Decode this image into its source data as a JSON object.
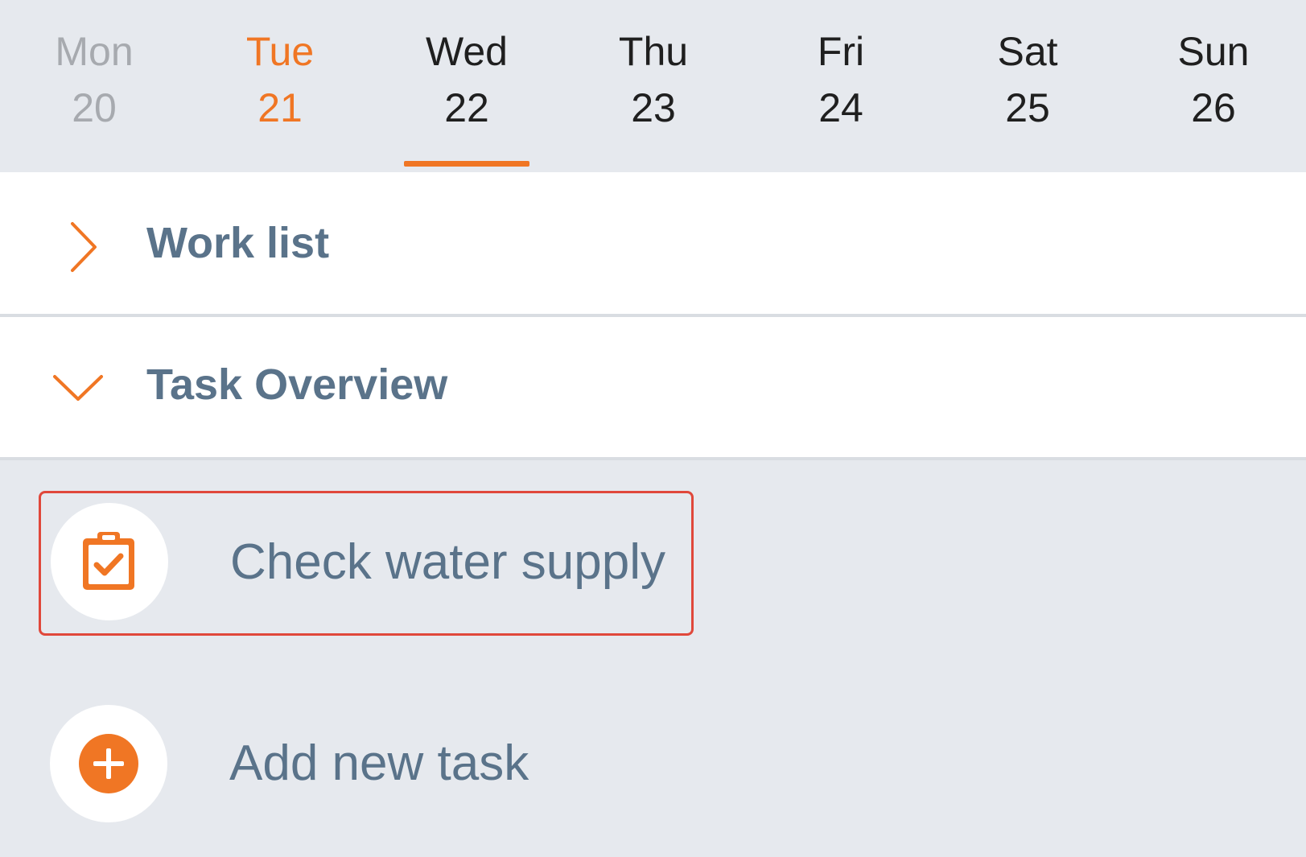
{
  "week": {
    "days": [
      {
        "name": "Mon",
        "num": "20",
        "state": "past"
      },
      {
        "name": "Tue",
        "num": "21",
        "state": "today"
      },
      {
        "name": "Wed",
        "num": "22",
        "state": "selected"
      },
      {
        "name": "Thu",
        "num": "23",
        "state": "future"
      },
      {
        "name": "Fri",
        "num": "24",
        "state": "future"
      },
      {
        "name": "Sat",
        "num": "25",
        "state": "future"
      },
      {
        "name": "Sun",
        "num": "26",
        "state": "future"
      }
    ]
  },
  "sections": {
    "work_list": {
      "title": "Work list",
      "expanded": false,
      "icon": "chevron-right-icon"
    },
    "task_overview": {
      "title": "Task Overview",
      "expanded": true,
      "icon": "chevron-down-icon"
    }
  },
  "tasks": [
    {
      "label": "Check water supply",
      "icon": "clipboard-check-icon"
    }
  ],
  "add_task": {
    "label": "Add new task",
    "icon": "plus-circle-icon"
  },
  "colors": {
    "accent": "#f07624",
    "label": "#5a738a",
    "background": "#e6e9ee",
    "highlight_border": "#e0483b",
    "past_day": "#a7aaaf"
  }
}
